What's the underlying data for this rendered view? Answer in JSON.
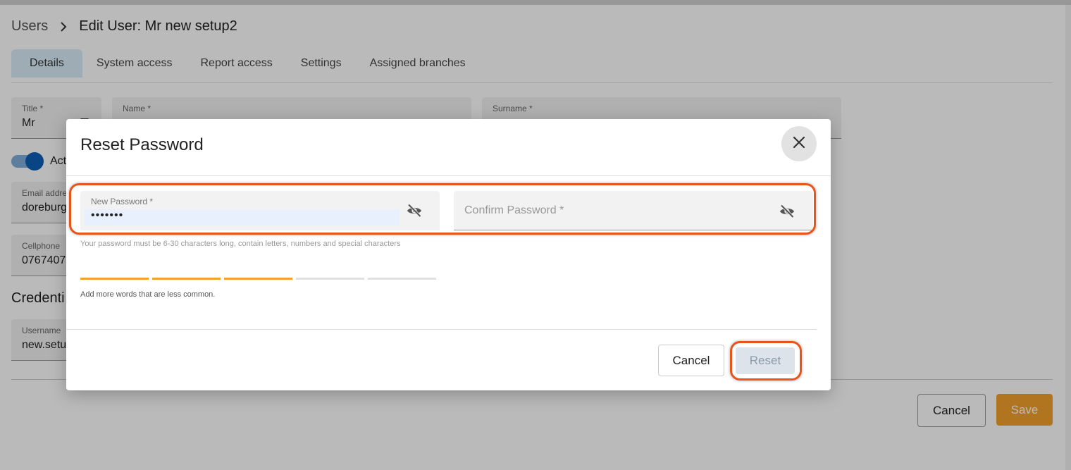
{
  "breadcrumb": {
    "parent": "Users",
    "current": "Edit User: Mr new setup2"
  },
  "tabs": [
    {
      "label": "Details"
    },
    {
      "label": "System access"
    },
    {
      "label": "Report access"
    },
    {
      "label": "Settings"
    },
    {
      "label": "Assigned branches"
    }
  ],
  "form": {
    "title": {
      "label": "Title *",
      "value": "Mr"
    },
    "name": {
      "label": "Name *",
      "value": ""
    },
    "surname": {
      "label": "Surname *",
      "value": ""
    },
    "active_label": "Act",
    "email": {
      "label": "Email addre",
      "value": "doreburg"
    },
    "cellphone": {
      "label": "Cellphone",
      "value": "0767407"
    },
    "credentials_title": "Credenti",
    "username": {
      "label": "Username",
      "value": "new.setu"
    }
  },
  "page_buttons": {
    "cancel": "Cancel",
    "save": "Save"
  },
  "modal": {
    "title": "Reset Password",
    "new_password": {
      "label": "New Password *",
      "value": "•••••••"
    },
    "confirm_password": {
      "placeholder": "Confirm Password *"
    },
    "hint": "Your password must be 6-30 characters long, contain letters, numbers and special characters",
    "strength": {
      "filled": 3,
      "total": 5
    },
    "feedback": "Add more words that are less common.",
    "cancel": "Cancel",
    "reset": "Reset"
  },
  "colors": {
    "accent": "#f2a12a",
    "highlight": "#e8541a",
    "active_tab": "#d9ecf8",
    "toggle": "#0d5eb5"
  },
  "icons": {
    "breadcrumb_sep": "chevron-right-icon",
    "close": "close-icon",
    "password_visibility": "eye-off-icon"
  }
}
